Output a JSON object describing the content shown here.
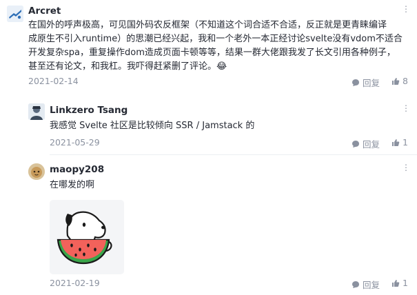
{
  "comments": [
    {
      "author": "Arcret",
      "lines": [
        "在国外的呼声极高，可见国外码农反框架（不知道这个词合适不合适，反正就是更青睐编译",
        "成原生不引入runtime）的思潮已经兴起，我和一个老外一本正经讨论svelte没有vdom不适合",
        "开发复杂spa，重复操作dom造成页面卡顿等等，结果一群大佬跟我发了长文引用各种例子，",
        "甚至还有论文，和我杠。我吓得赶紧删了评论。"
      ],
      "emoji": "😂",
      "date": "2021-02-14",
      "reply_label": "回复",
      "likes": "8"
    },
    {
      "author": "Linkzero Tsang",
      "text": "我感觉 Svelte 社区是比较倾向 SSR / Jamstack 的",
      "date": "2021-05-29",
      "reply_label": "回复",
      "likes": "1"
    },
    {
      "author": "maopy208",
      "text": "在哪发的啊",
      "date": "2021-02-19",
      "reply_label": "回复",
      "likes": "1"
    }
  ],
  "more_glyph": "⋮",
  "icons": {
    "reply": "comment-icon",
    "like": "thumbs-up-icon",
    "more": "more-options-icon",
    "sticker": "watermelon-dog-sticker"
  },
  "colors": {
    "text": "#252933",
    "meta": "#8a919f",
    "divider": "#ebeef2"
  }
}
